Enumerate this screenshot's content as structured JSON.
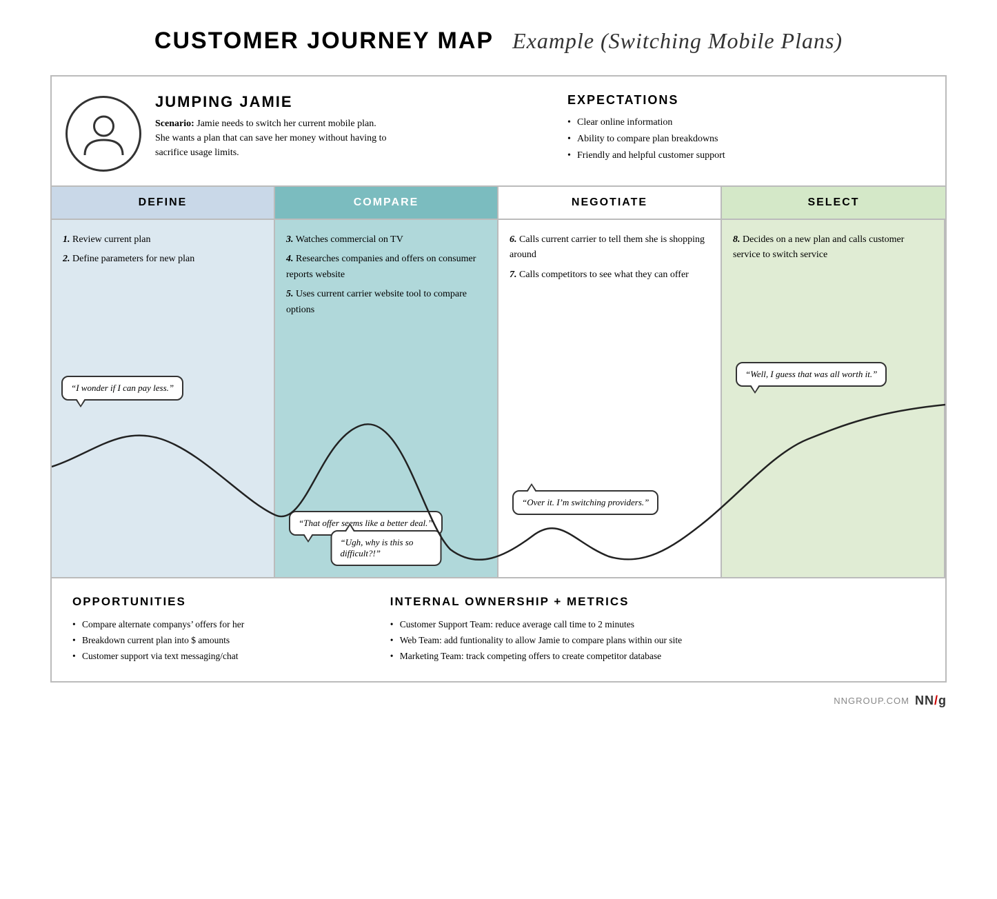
{
  "title": {
    "bold": "CUSTOMER JOURNEY MAP",
    "italic": "Example (Switching Mobile Plans)"
  },
  "persona": {
    "name": "JUMPING JAMIE",
    "scenario_label": "Scenario:",
    "scenario_text": "Jamie needs to switch her current mobile plan. She wants a plan that can save her money without having to sacrifice usage limits."
  },
  "expectations": {
    "title": "EXPECTATIONS",
    "items": [
      "Clear online information",
      "Ability to compare plan breakdowns",
      "Friendly and helpful customer support"
    ]
  },
  "phases": {
    "define": "DEFINE",
    "compare": "COMPARE",
    "negotiate": "NEGOTIATE",
    "select": "SELECT"
  },
  "journey": {
    "define": {
      "steps": [
        "1. Review current plan",
        "2. Define parameters for new plan"
      ],
      "bubble": "“I wonder if I can pay less.”"
    },
    "compare": {
      "steps": [
        "3. Watches commercial on TV",
        "4. Researches companies and offers on consumer reports website",
        "5. Uses current carrier website tool to compare options"
      ],
      "bubble1": "“That offer seems like a better deal.”",
      "bubble2": "“Ugh, why is this so difficult?!”"
    },
    "negotiate": {
      "steps": [
        "6. Calls current carrier to tell them she is shopping around",
        "7. Calls competitors to see what they can offer"
      ],
      "bubble": "“Over it. I’m switching providers.”"
    },
    "select": {
      "steps": [
        "8. Decides on a new plan and calls customer service to switch service"
      ],
      "bubble": "“Well, I guess that was all worth it.”"
    }
  },
  "opportunities": {
    "title": "OPPORTUNITIES",
    "items": [
      "Compare alternate companys’ offers for her",
      "Breakdown current plan into $ amounts",
      "Customer support via text messaging/chat"
    ]
  },
  "internal": {
    "title": "INTERNAL OWNERSHIP + METRICS",
    "items": [
      "Customer Support Team: reduce average call time to 2 minutes",
      "Web Team: add funtionality to allow Jamie to compare plans within our site",
      "Marketing Team: track competing offers to create competitor database"
    ]
  },
  "footer": {
    "text": "NNGROUP.COM",
    "logo_nn": "NN",
    "logo_slash": "/",
    "logo_g": "g"
  }
}
